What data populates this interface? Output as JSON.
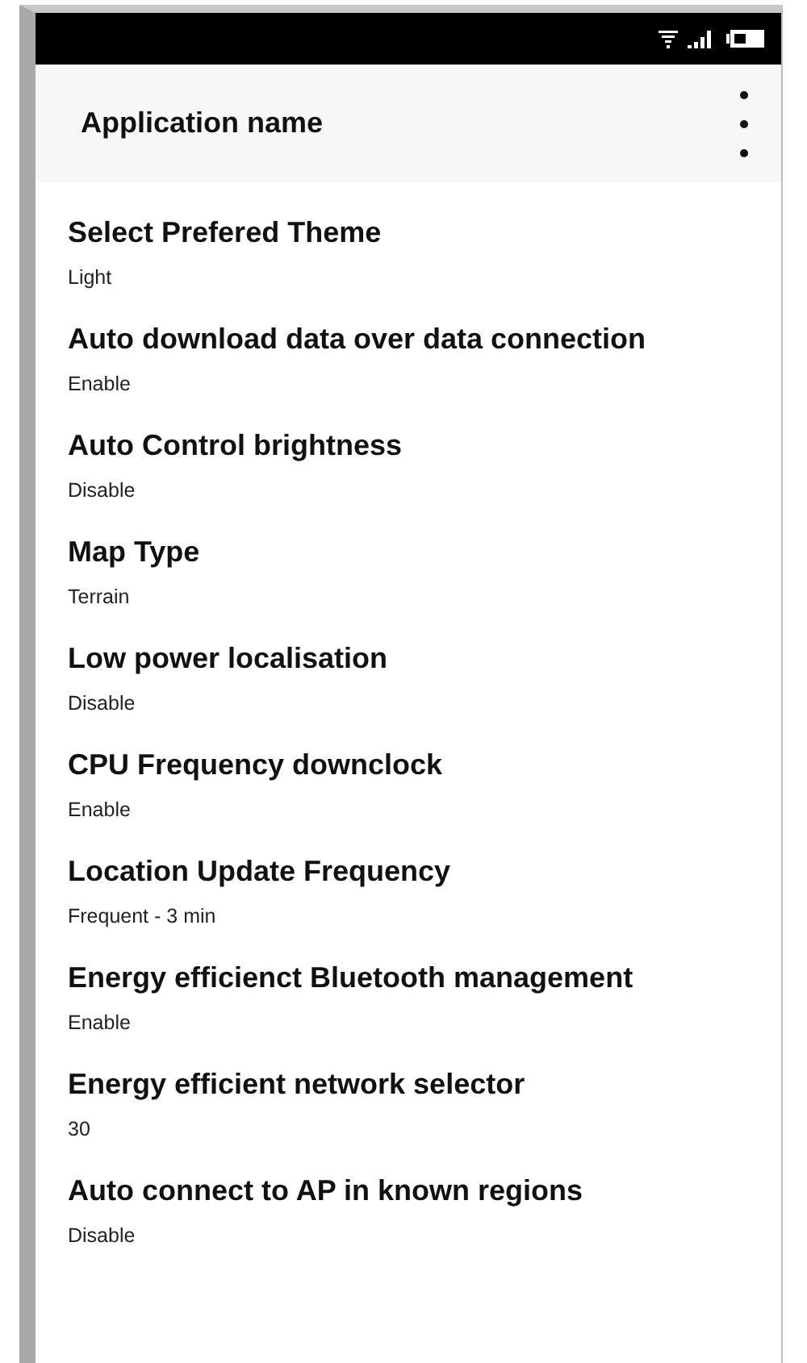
{
  "app_bar": {
    "title": "Application name"
  },
  "settings": [
    {
      "title": "Select Prefered Theme",
      "value": "Light"
    },
    {
      "title": "Auto download data over data connection",
      "value": "Enable"
    },
    {
      "title": "Auto Control brightness",
      "value": "Disable"
    },
    {
      "title": "Map Type",
      "value": "Terrain"
    },
    {
      "title": "Low power localisation",
      "value": "Disable"
    },
    {
      "title": "CPU Frequency downclock",
      "value": "Enable"
    },
    {
      "title": "Location Update Frequency",
      "value": "Frequent - 3 min"
    },
    {
      "title": "Energy efficienct Bluetooth management",
      "value": "Enable"
    },
    {
      "title": "Energy efficient network selector",
      "value": "30"
    },
    {
      "title": "Auto connect to AP in known regions",
      "value": "Disable"
    }
  ]
}
